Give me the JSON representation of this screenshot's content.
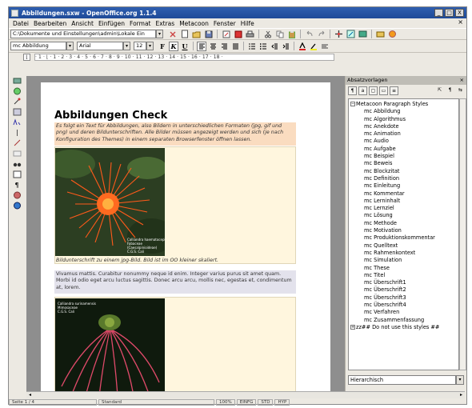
{
  "window": {
    "title": "Abbildungen.sxw - OpenOffice.org 1.1.4",
    "min_label": "_",
    "max_label": "□",
    "close_label": "X"
  },
  "menu": {
    "items": [
      "Datei",
      "Bearbeiten",
      "Ansicht",
      "Einfügen",
      "Format",
      "Extras",
      "Metacoon",
      "Fenster",
      "Hilfe"
    ],
    "close_doc": "×"
  },
  "toolbar": {
    "url": "C:\\Dokumente und Einstellungen\\admin\\Lokale Ein",
    "dropdown_arrow": "▾"
  },
  "format_bar": {
    "paragraph_style": "mc Abbildung",
    "font_name": "Arial",
    "font_size": "12",
    "bold": "F",
    "italic": "K",
    "underline": "U"
  },
  "ruler": {
    "text": "· 1 · ⌊ · 1 · 2 · 3 · 4 · 5 · 6 · 7 · 8 · 9 · 10 · 11 · 12 · 13 · 14 · 15 · 16 · 17 · 18 ·"
  },
  "document": {
    "heading": "Abbildungen Check",
    "intro": "Es folgt ein Text für Abbildungen, also Bildern in unterschiedlichen Formaten (jpg, gif und png) und deren Bildunterschriften. Alle Bilder müssen angezeigt werden und sich (je nach Konfiguration des Themes) in einem separaten Browserfenster öffnen lassen.",
    "caption": "Bildunterschrift zu einem jpg-Bild. Bild ist im OO kleiner skaliert.",
    "body": "Vivamus mattis. Curabitur nonummy neque id enim. Integer varius purus sit amet quam. Morbi id odio eget arcu luctus sagittis. Donec arcu arcu, mollis nec, egestas et, condimentum at, lorem.",
    "photo1_info": "Calliandra haematocephala\nFabaceae\n(Caesalpinioideae)\nC.G.S. Cali",
    "photo2_info": "Calliandra surinamensis\nMimosaceae\nC.G.S. Cali"
  },
  "styles_panel": {
    "title": "Absatzvorlagen",
    "close": "×",
    "root": "Metacoon Paragraph Styles",
    "items": [
      "mc Abbildung",
      "mc Algorithmus",
      "mc Anekdote",
      "mc Animation",
      "mc Audio",
      "mc Aufgabe",
      "mc Beispiel",
      "mc Beweis",
      "mc Blockzitat",
      "mc Definition",
      "mc Einleitung",
      "mc Kommentar",
      "mc Lerninhalt",
      "mc Lernziel",
      "mc Lösung",
      "mc Methode",
      "mc Motivation",
      "mc Produktionskommentar",
      "mc Quelltext",
      "mc Rahmenkontext",
      "mc Simulation",
      "mc These",
      "mc Titel",
      "mc Überschrift1",
      "mc Überschrift2",
      "mc Überschrift3",
      "mc Überschrift4",
      "mc Verfahren",
      "mc Zusammenfassung"
    ],
    "extra": "zz## Do not use this styles ##",
    "filter": "Hierarchisch",
    "expander_open": "−",
    "expander_closed": "+"
  },
  "status": {
    "page": "Seite 1 / 4",
    "style": "Standard",
    "mode1": "100%",
    "mode2": "EINFG",
    "mode3": "STD",
    "mode4": "HYP"
  }
}
